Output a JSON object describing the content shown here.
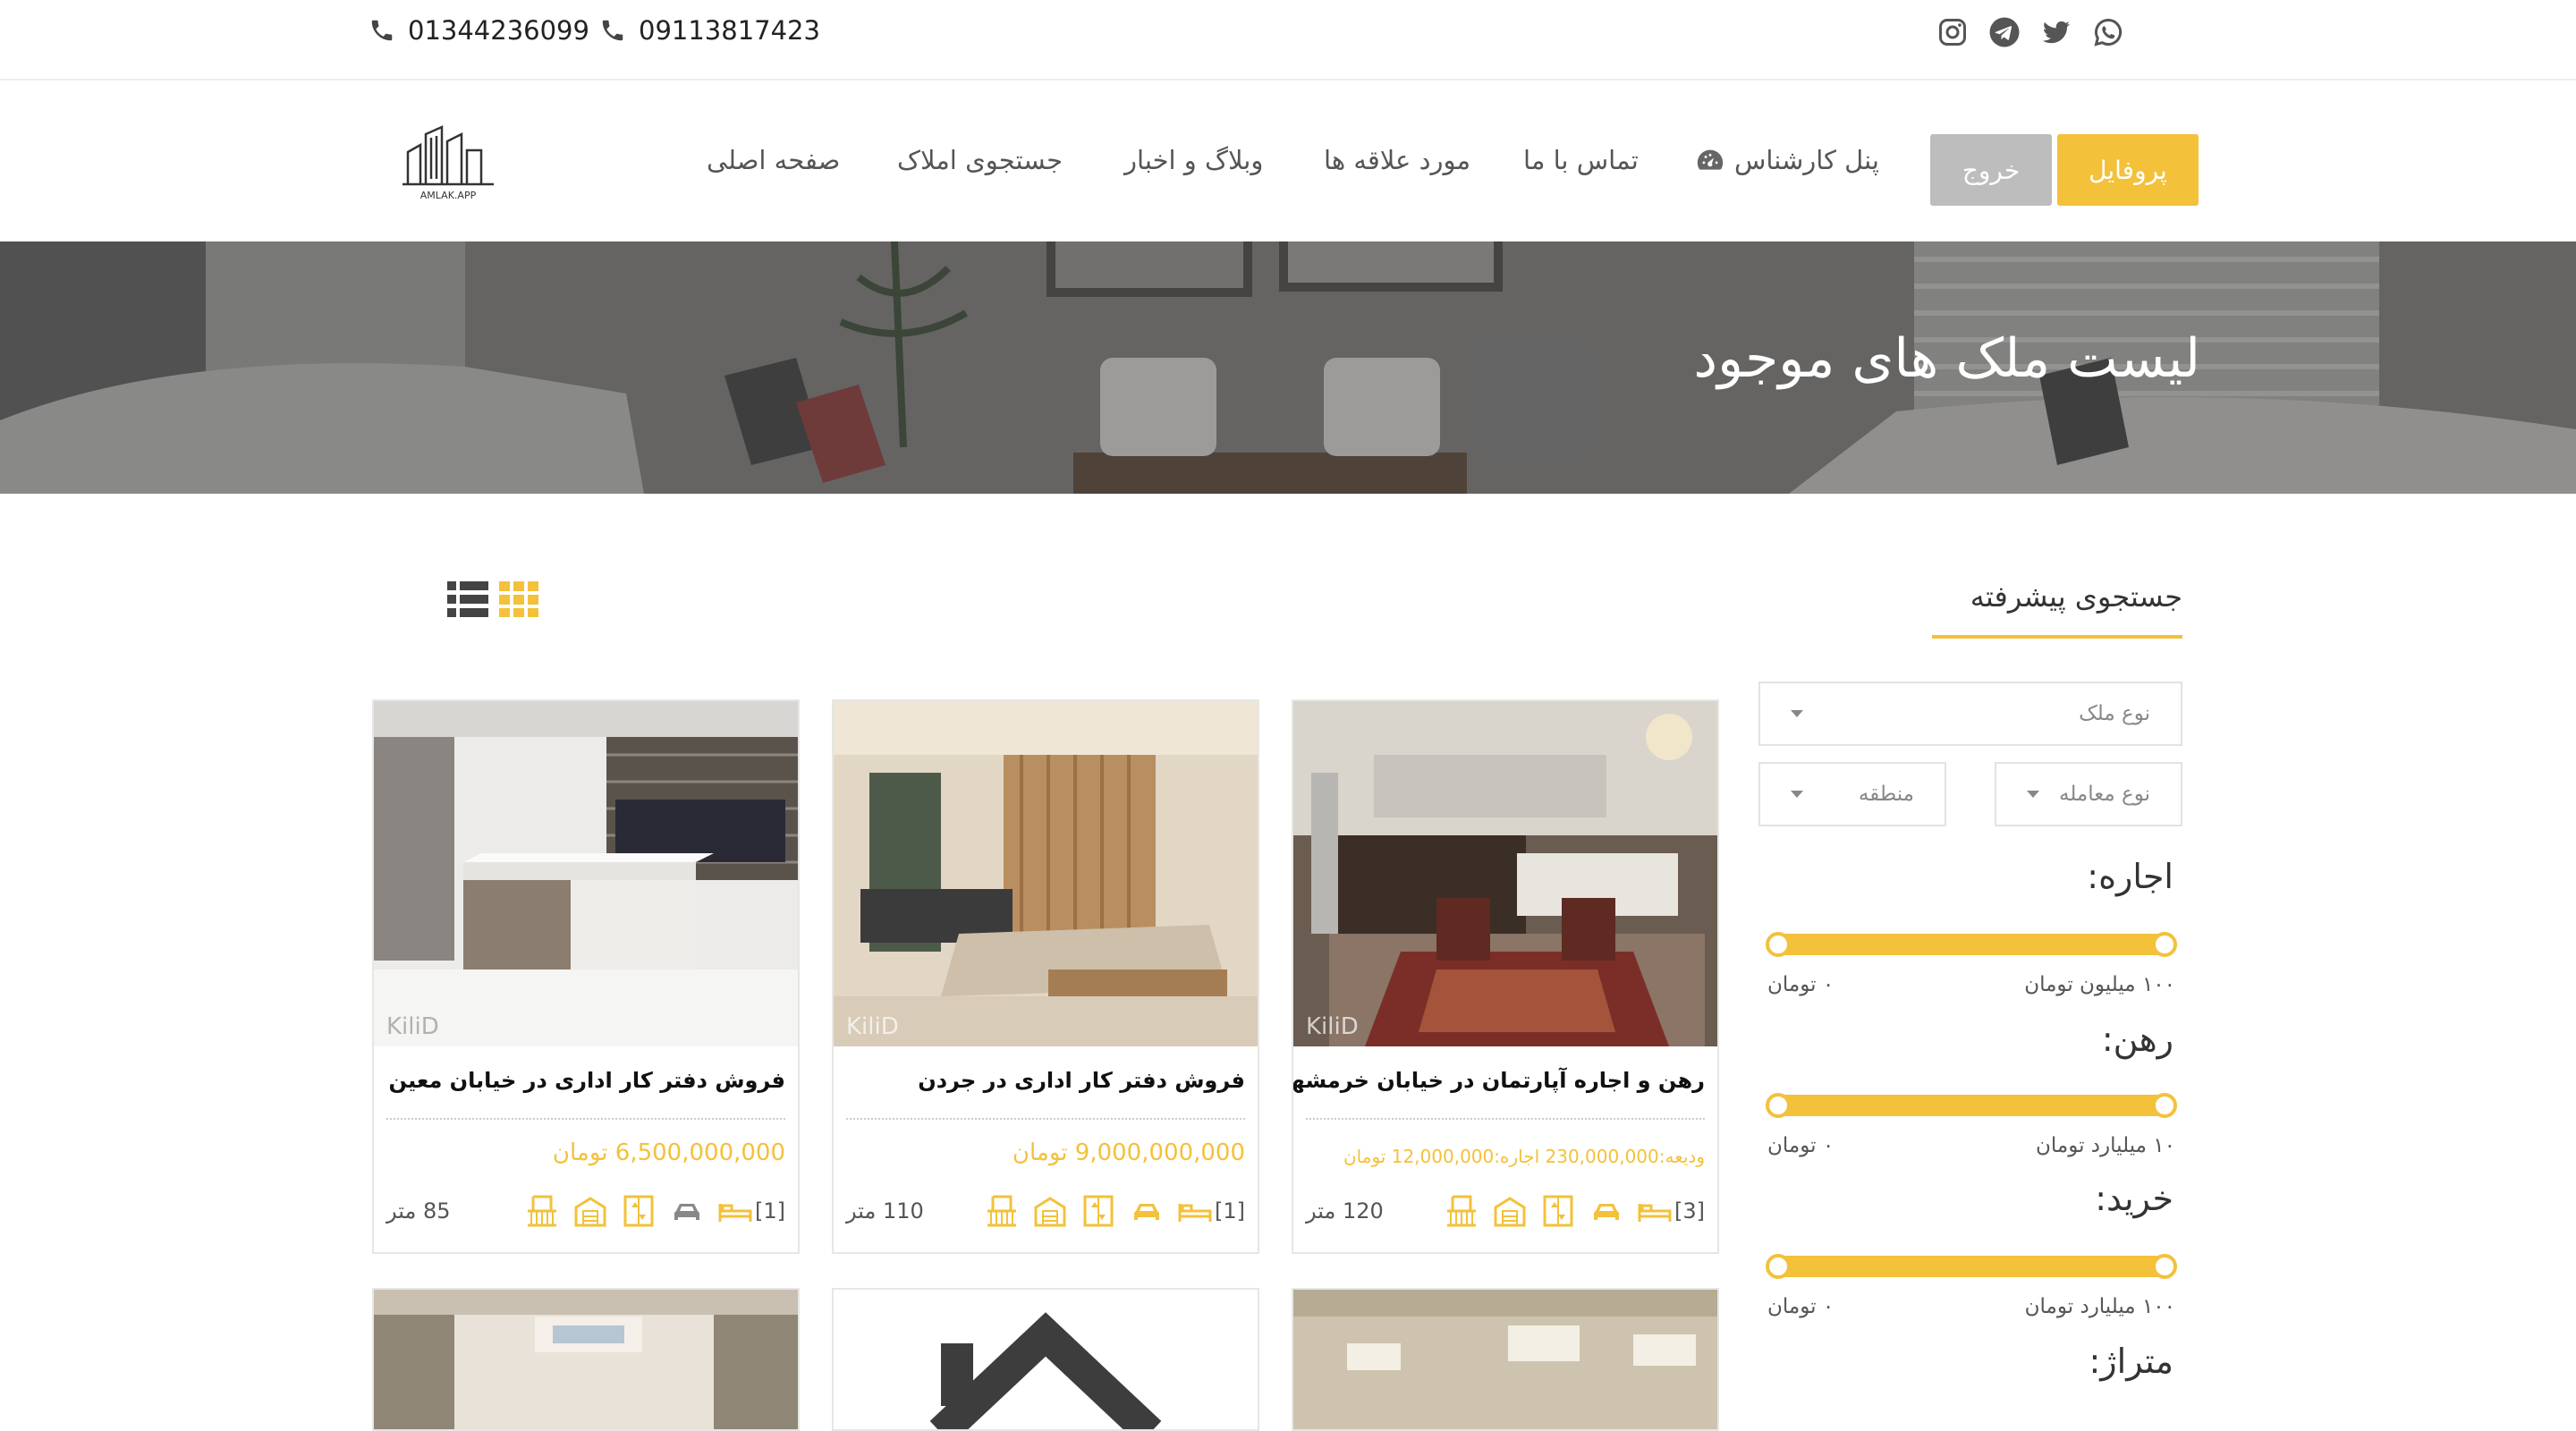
{
  "topbar": {
    "phones": [
      "01344236099",
      "09113817423"
    ],
    "socials": [
      "instagram-icon",
      "telegram-icon",
      "twitter-icon",
      "whatsapp-icon"
    ]
  },
  "logo": {
    "text": "AMLAK.APP"
  },
  "nav": {
    "home": "صفحه اصلی",
    "property_search": "جستجوی املاک",
    "blog": "وبلاگ و اخبار",
    "favorites": "مورد علاقه ها",
    "contact": "تماس با ما",
    "agent_panel": "پنل کارشناس",
    "exit": "خروج",
    "profile": "پروفایل"
  },
  "hero": {
    "title": "لیست ملک های موجود"
  },
  "sidebar": {
    "title": "جستجوی پیشرفته",
    "property_type": "نوع ملک",
    "deal_type": "نوع معامله",
    "region": "منطقه",
    "rent_label": "اجاره:",
    "rent_min": "۰ تومان",
    "rent_max": "۱۰۰ میلیون تومان",
    "mortgage_label": "رهن:",
    "mortgage_min": "۰ تومان",
    "mortgage_max": "۱۰ میلیارد تومان",
    "buy_label": "خرید:",
    "buy_min": "۰ تومان",
    "buy_max": "۱۰۰ میلیارد تومان",
    "area_label": "متراژ:"
  },
  "view": {
    "list_icon": "list-view-icon",
    "grid_icon": "grid-view-icon",
    "active": "grid"
  },
  "listings": [
    {
      "title": "رهن و اجاره آپارتمان در خیابان خرمشهر",
      "price": "ودیعه:230,000,000 اجاره:12,000,000 تومان",
      "rooms": "[3]",
      "area": "120 متر"
    },
    {
      "title": "فروش دفتر کار اداری در جردن",
      "price": "9,000,000,000 تومان",
      "rooms": "[1]",
      "area": "110 متر"
    },
    {
      "title": "فروش دفتر کار اداری در خیابان معین",
      "price": "6,500,000,000 تومان",
      "rooms": "[1]",
      "area": "85 متر"
    }
  ],
  "colors": {
    "accent": "#f3c13a",
    "exit_button": "#bdbdbd"
  }
}
